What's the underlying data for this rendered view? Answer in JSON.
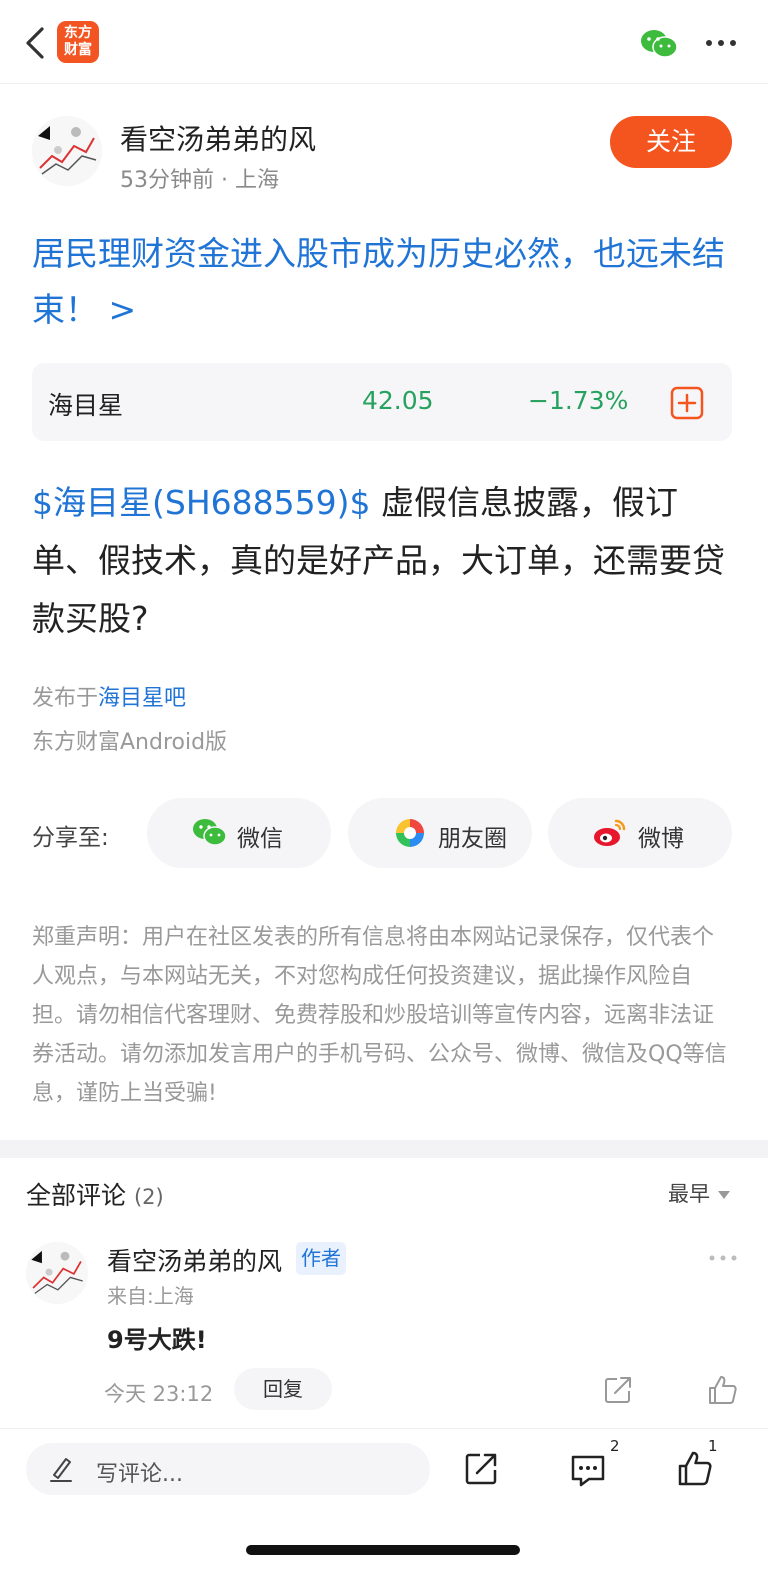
{
  "header": {
    "logo_line1": "东方",
    "logo_line2": "财富",
    "icons": [
      "back-icon",
      "wechat-icon",
      "more-icon"
    ]
  },
  "post": {
    "author": "看空汤弟弟的风",
    "meta": "53分钟前 · 上海",
    "follow_label": "关注",
    "headline": "居民理财资金进入股市成为历史必然，也远未结束！ >",
    "stock": {
      "name": "海目星",
      "price": "42.05",
      "change": "−1.73%",
      "color": "#27a15e"
    },
    "body_tag": "$海目星(SH688559)$",
    "body_text": "  虚假信息披露，假订单、假技术，真的是好产品，大订单，还需要贷款买股?",
    "published_prefix": "发布于",
    "published_link": "海目星吧",
    "client": "东方财富Android版"
  },
  "share": {
    "label": "分享至:",
    "targets": [
      {
        "label": "微信",
        "icon": "wechat-icon"
      },
      {
        "label": "朋友圈",
        "icon": "moments-icon"
      },
      {
        "label": "微博",
        "icon": "weibo-icon"
      }
    ]
  },
  "disclaimer": "郑重声明：用户在社区发表的所有信息将由本网站记录保存，仅代表个人观点，与本网站无关，不对您构成任何投资建议，据此操作风险自担。请勿相信代客理财、免费荐股和炒股培训等宣传内容，远离非法证券活动。请勿添加发言用户的手机号码、公众号、微博、微信及QQ等信息，谨防上当受骗!",
  "comments": {
    "title": "全部评论",
    "count": "(2)",
    "sort": "最早",
    "items": [
      {
        "author": "看空汤弟弟的风",
        "badge": "作者",
        "from": "来自:上海",
        "text": "9号大跌!",
        "time": "今天 23:12",
        "reply_label": "回复"
      }
    ]
  },
  "bottom": {
    "placeholder": "写评论...",
    "comment_count": "2",
    "like_count": "1"
  },
  "colors": {
    "brand": "#f4541d",
    "link": "#1f74d6",
    "down": "#27a15e"
  }
}
